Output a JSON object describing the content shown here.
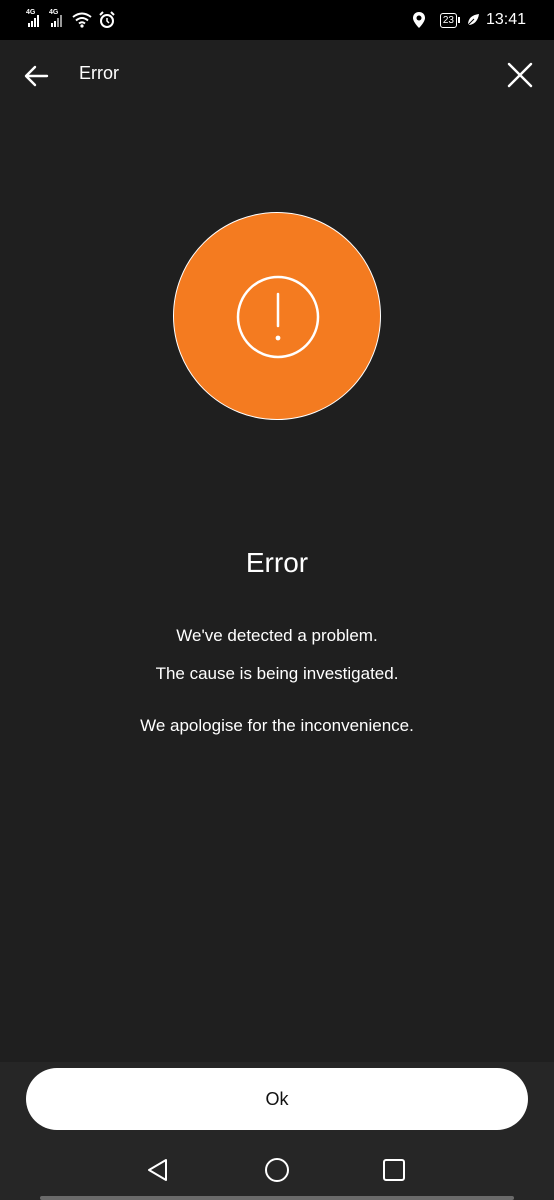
{
  "status_bar": {
    "network_left": "4G",
    "network_right": "4G",
    "battery": "23",
    "time": "13:41"
  },
  "app_bar": {
    "title": "Error",
    "back_icon": "arrow-left-icon",
    "close_icon": "close-icon"
  },
  "content": {
    "icon": "exclamation-circle-icon",
    "accent_color": "#f47b20",
    "heading": "Error",
    "line1": "We've detected a problem.",
    "line2": "The cause is being investigated.",
    "line3": "We apologise for the inconvenience."
  },
  "actions": {
    "ok_label": "Ok"
  },
  "nav": {
    "back": "nav-back-icon",
    "home": "nav-home-icon",
    "recents": "nav-recents-icon"
  }
}
